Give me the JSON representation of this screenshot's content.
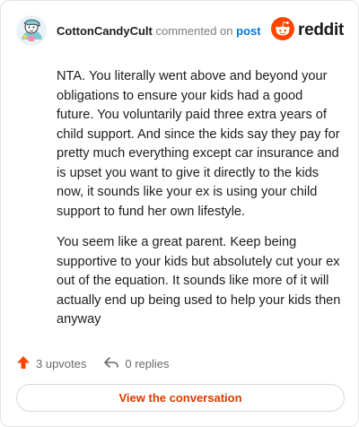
{
  "comment": {
    "username": "CottonCandyCult",
    "commented_on_text": "commented on",
    "post_link_text": "post",
    "paragraphs": [
      "NTA. You literally went above and beyond your obligations to ensure your kids had a good future. You voluntarily paid three extra years of child support. And since the kids say they pay for pretty much everything except car insurance and is upset you want to give it directly to the kids now, it sounds like your ex is using your child support to fund her own lifestyle.",
      "You seem like a great parent. Keep being supportive to your kids but absolutely cut your ex out of the equation. It sounds like more of it will actually end up being used to help your kids then anyway"
    ]
  },
  "brand": {
    "name": "reddit",
    "icon": "reddit-alien-icon",
    "color": "#ff4500"
  },
  "actions": {
    "upvotes_label": "3 upvotes",
    "upvote_icon": "upvote-arrow-icon",
    "replies_label": "0 replies",
    "reply_icon": "reply-arrow-icon"
  },
  "footer": {
    "view_conversation_label": "View the conversation"
  },
  "colors": {
    "link_blue": "#0079d3",
    "accent_orange": "#d93a00",
    "upvote_orange": "#ff4500"
  }
}
